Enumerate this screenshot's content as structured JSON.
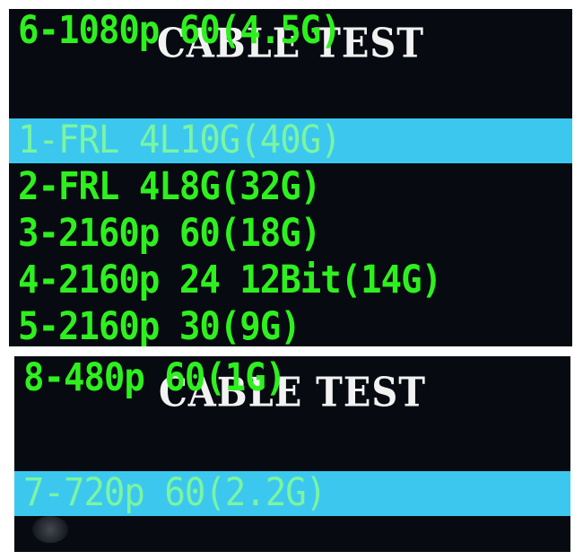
{
  "screen1": {
    "title": "CABLE TEST",
    "items": [
      {
        "label": "1-FRL 4L10G(40G)",
        "selected": true
      },
      {
        "label": "2-FRL 4L8G(32G)",
        "selected": false
      },
      {
        "label": "3-2160p 60(18G)",
        "selected": false
      },
      {
        "label": "4-2160p 24 12Bit(14G)",
        "selected": false
      },
      {
        "label": "5-2160p 30(9G)",
        "selected": false
      },
      {
        "label": "6-1080p 60(4.5G)",
        "selected": false
      }
    ]
  },
  "screen2": {
    "title": "CABLE TEST",
    "items": [
      {
        "label": "7-720p 60(2.2G)",
        "selected": true
      },
      {
        "label": "8-480p 60(1G)",
        "selected": false
      }
    ]
  },
  "colors": {
    "screen_bg": "#070a10",
    "title_text": "#f2f2f2",
    "item_text": "#2ef01e",
    "selected_bg": "#3cc8ee",
    "selected_text": "#7af5a2"
  }
}
